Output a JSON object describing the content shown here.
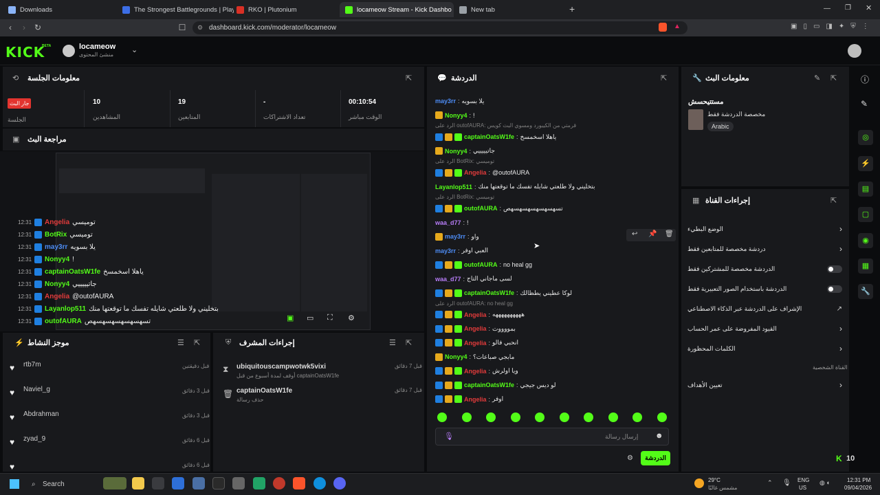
{
  "browser": {
    "tabs": [
      {
        "title": "Downloads",
        "color": "#8ab4f8"
      },
      {
        "title": "The Strongest Battlegrounds | Play o",
        "color": "#3c6ee6"
      },
      {
        "title": "RKO | Plutonium",
        "color": "#d93025"
      },
      {
        "title": "locameow Stream - Kick Dashbo",
        "color": "#53fc18"
      },
      {
        "title": "New tab",
        "color": "#9aa0a6"
      }
    ],
    "new_tab_symbol": "+",
    "url": "dashboard.kick.com/moderator/locameow"
  },
  "header": {
    "logo": "KICK",
    "logo_beta": "BETA",
    "channel_name": "locameow",
    "channel_sub": "منشئ المحتوى"
  },
  "session": {
    "title": "معلومات الجلسة",
    "live_badge": "جار البث",
    "stats": [
      {
        "label": "الجلسة",
        "value": ""
      },
      {
        "label": "المشاهدين",
        "value": "10"
      },
      {
        "label": "المتابعين",
        "value": "19"
      },
      {
        "label": "تعداد الاشتراكات",
        "value": "-"
      },
      {
        "label": "الوقت مباشر",
        "value": "00:10:54"
      }
    ]
  },
  "preview": {
    "title": "مراجعة البث",
    "overlay_lines": [
      {
        "time": "12:31",
        "user": "Angelia",
        "text": "توميسي",
        "color": "#e33b3b"
      },
      {
        "time": "12:31",
        "user": "BotRix",
        "text": "توميسي",
        "color": "#53fc18"
      },
      {
        "time": "12:31",
        "user": "may3rr",
        "text": "يلا بسويه",
        "color": "#4d8cf5"
      },
      {
        "time": "12:31",
        "user": "Nonyy4",
        "text": "!",
        "color": "#53fc18"
      },
      {
        "time": "12:31",
        "user": "captainOatsW1fe",
        "text": "ياهلا اسخمسخ",
        "color": "#53fc18"
      },
      {
        "time": "12:31",
        "user": "Nonyy4",
        "text": "جاتيييييي",
        "color": "#53fc18"
      },
      {
        "time": "12:31",
        "user": "Angelia",
        "text": "@outofAURA",
        "color": "#e33b3b"
      },
      {
        "time": "12:31",
        "user": "Layanlop511",
        "text": "بتخليني ولا طلعتي شايله تفسك ما توقعتها منك",
        "color": "#53fc18"
      },
      {
        "time": "12:31",
        "user": "outofAURA",
        "text": "تسهسهسهسهسهسهص",
        "color": "#53fc18"
      }
    ]
  },
  "activity": {
    "title": "موجز النشاط",
    "items": [
      {
        "name": "rtb7m",
        "time": "قبل دقيقتين"
      },
      {
        "name": "Naviel_g",
        "time": "قبل 3 دقائق"
      },
      {
        "name": "Abdrahman",
        "time": "قبل 3 دقائق"
      },
      {
        "name": "zyad_9",
        "time": "قبل 6 دقائق"
      },
      {
        "name": "",
        "time": "قبل 6 دقائق"
      }
    ]
  },
  "mod_actions": {
    "title": "إجراءات المشرف",
    "items": [
      {
        "user": "ubiquitouscampwotwk5vixi",
        "desc": "أوقف لمدة أسبوع من قبل captainOatsW1fe",
        "time": "قبل 7 دقائق"
      },
      {
        "user": "captainOatsW1fe",
        "desc": "حذف رسالة",
        "time": "قبل 7 دقائق"
      }
    ]
  },
  "chat": {
    "title": "الدردشة",
    "input_placeholder": "إرسال رسالة",
    "send_label": "الدردشة",
    "messages": [
      {
        "user": "may3rr",
        "text": "يلا بسويه",
        "color": "#4d8cf5",
        "badges": [],
        "reply": ""
      },
      {
        "user": "Nonyy4",
        "text": "!",
        "color": "#53fc18",
        "badges": [
          "vip"
        ],
        "reply": ""
      },
      {
        "user": "captainOatsW1fe",
        "text": "ياهلا اسخمسخ",
        "color": "#53fc18",
        "badges": [
          "mod",
          "vip",
          "sub"
        ],
        "reply": "الرد على outofAURA: قرمتي من الكيبورد ومسوي البث كويس"
      },
      {
        "user": "Nonyy4",
        "text": "جاتيييييي",
        "color": "#53fc18",
        "badges": [
          "vip"
        ],
        "reply": ""
      },
      {
        "user": "Angelia",
        "text": "@outofAURA",
        "color": "#e33b3b",
        "badges": [
          "mod",
          "vip",
          "sub"
        ],
        "reply": "الرد على BotRix: توميسي"
      },
      {
        "user": "Layanlop511",
        "text": "بتخليني ولا طلعتي شايله تفسك ما توقعتها منك",
        "color": "#53fc18",
        "badges": [],
        "reply": ""
      },
      {
        "user": "outofAURA",
        "text": "تسهسهسهسهسهسهص",
        "color": "#53fc18",
        "badges": [
          "mod",
          "vip",
          "sub"
        ],
        "reply": "الرد على BotRix: توميسي"
      },
      {
        "user": "waa_d77",
        "text": "!",
        "color": "#b57cf5",
        "badges": [],
        "reply": ""
      },
      {
        "user": "may3rr",
        "text": "واو",
        "color": "#4d8cf5",
        "badges": [
          "vip"
        ],
        "reply": ""
      },
      {
        "user": "may3rr",
        "text": "العبي اوفر",
        "color": "#4d8cf5",
        "badges": [],
        "reply": ""
      },
      {
        "user": "outofAURA",
        "text": "no heal gg",
        "color": "#53fc18",
        "badges": [
          "mod",
          "vip",
          "sub"
        ],
        "reply": ""
      },
      {
        "user": "waa_d77",
        "text": "لسى ماجاني التاج",
        "color": "#b57cf5",
        "badges": [],
        "reply": ""
      },
      {
        "user": "captainOatsW1fe",
        "text": "لوكا عطيني يطظالك",
        "color": "#53fc18",
        "badges": [
          "mod",
          "vip",
          "sub"
        ],
        "reply": ""
      },
      {
        "user": "Angelia",
        "text": "ههههههههههه",
        "color": "#e33b3b",
        "badges": [
          "mod",
          "vip",
          "sub"
        ],
        "reply": "الرد على outofAURA: no heal gg"
      },
      {
        "user": "Angelia",
        "text": "بمووووت",
        "color": "#e33b3b",
        "badges": [
          "mod",
          "vip",
          "sub"
        ],
        "reply": ""
      },
      {
        "user": "Angelia",
        "text": "انحبي فالو",
        "color": "#e33b3b",
        "badges": [
          "mod",
          "vip",
          "sub"
        ],
        "reply": ""
      },
      {
        "user": "Nonyy4",
        "text": "مابجي صباعات؟",
        "color": "#53fc18",
        "badges": [
          "vip"
        ],
        "reply": ""
      },
      {
        "user": "Angelia",
        "text": "ويا اولرش",
        "color": "#e33b3b",
        "badges": [
          "mod",
          "vip",
          "sub"
        ],
        "reply": ""
      },
      {
        "user": "captainOatsW1fe",
        "text": "لو ديس جيجي",
        "color": "#53fc18",
        "badges": [
          "mod",
          "vip",
          "sub"
        ],
        "reply": ""
      },
      {
        "user": "Angelia",
        "text": "اوفر",
        "color": "#e33b3b",
        "badges": [
          "mod",
          "vip",
          "sub"
        ],
        "reply": ""
      }
    ]
  },
  "stream_info": {
    "title": "معلومات البث",
    "stream_title": "مستتيحسش",
    "category": "مخصصة الدردشة فقط",
    "language": "Arabic"
  },
  "channel_actions": {
    "title": "إجراءات القناة",
    "rows": [
      {
        "label": "الوضع البطيء",
        "control": "chevron"
      },
      {
        "label": "دردشة مخصصة للمتابعين فقط",
        "control": "chevron"
      },
      {
        "label": "الدردشة مخصصة للمشتركين فقط",
        "control": "toggle"
      },
      {
        "label": "الدردشة باستخدام الصور التعبيرية فقط",
        "control": "toggle"
      },
      {
        "label": "الإشراف على الدردشة عبر الذكاء الاصطناعي",
        "control": "link"
      },
      {
        "label": "القيود المفروضة على عمر الحساب",
        "control": "chevron"
      },
      {
        "label": "الكلمات المحظورة",
        "control": "chevron"
      }
    ],
    "section_label": "القناة الشخصية",
    "goals_label": "تعيين الأهداف"
  },
  "footer_badge": {
    "label": "10"
  },
  "taskbar": {
    "search": "Search",
    "weather_temp": "29°C",
    "weather_desc": "مشمس غالبًا",
    "lang": "ENG",
    "region": "US",
    "time": "12:31 PM",
    "date": "09/04/2026"
  }
}
